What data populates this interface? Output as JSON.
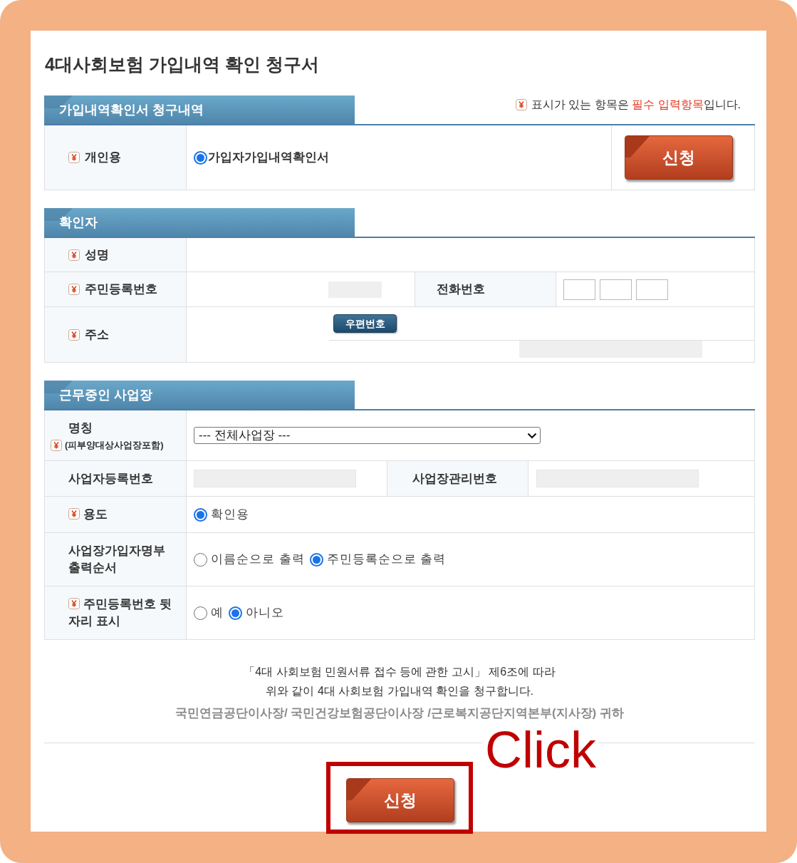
{
  "title": "4대사회보험 가입내역 확인 청구서",
  "required_note": {
    "before": "표시가 있는 항목은 ",
    "highlight": "필수 입력항목",
    "after": "입니다."
  },
  "request": {
    "title": "가입내역확인서 청구내역",
    "label": "개인용",
    "required": true,
    "options": [
      {
        "label": "가입자가입내역확인서",
        "selected": true
      }
    ],
    "button": "신청"
  },
  "confirmer": {
    "title": "확인자",
    "name": {
      "label": "성명",
      "required": true
    },
    "resident_number": {
      "label": "주민등록번호",
      "required": true
    },
    "phone": {
      "label": "전화번호"
    },
    "address": {
      "label": "주소",
      "required": true,
      "zip_button": "우편번호"
    }
  },
  "workplace": {
    "title": "근무중인 사업장",
    "name": {
      "label": "명칭",
      "note": "(피부양대상사업장포함)",
      "required": true,
      "select": "--- 전체사업장 ---"
    },
    "business_number": {
      "label": "사업자등록번호"
    },
    "management_number": {
      "label": "사업장관리번호"
    },
    "option_rows": [
      {
        "label": "용도",
        "required": true,
        "options": [
          {
            "label": "확인용",
            "selected": true
          }
        ]
      },
      {
        "label": "사업장가입자명부 출력순서",
        "required": false,
        "options": [
          {
            "label": "이름순으로 출력",
            "selected": false
          },
          {
            "label": "주민등록순으로 출력",
            "selected": true
          }
        ]
      },
      {
        "label": "주민등록번호 뒷자리 표시",
        "required": true,
        "options": [
          {
            "label": "예",
            "selected": false
          },
          {
            "label": "아니오",
            "selected": true
          }
        ]
      }
    ]
  },
  "notice": [
    "「4대 사회보험 민원서류 접수 등에 관한 고시」 제6조에 따라",
    "위와 같이 4대 사회보험 가입내역 확인을 청구합니다."
  ],
  "addressee": "국민연금공단이사장/ 국민건강보험공단이사장 /근로복지공단지역본부(지사장) 귀하",
  "submit": {
    "button": "신청"
  },
  "annotation": {
    "text": "Click"
  }
}
